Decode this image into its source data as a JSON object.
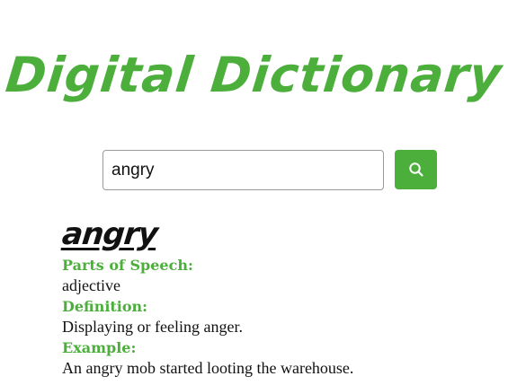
{
  "app": {
    "title": "Digital Dictionary",
    "accent_color": "#4caf3c"
  },
  "search": {
    "value": "angry",
    "button_icon": "search-icon"
  },
  "result": {
    "word": "angry",
    "parts_of_speech_label": "Parts of Speech:",
    "parts_of_speech": "adjective",
    "definition_label": "Definition:",
    "definition": "Displaying or feeling anger.",
    "example_label": "Example:",
    "example": "An angry mob started looting the warehouse."
  }
}
